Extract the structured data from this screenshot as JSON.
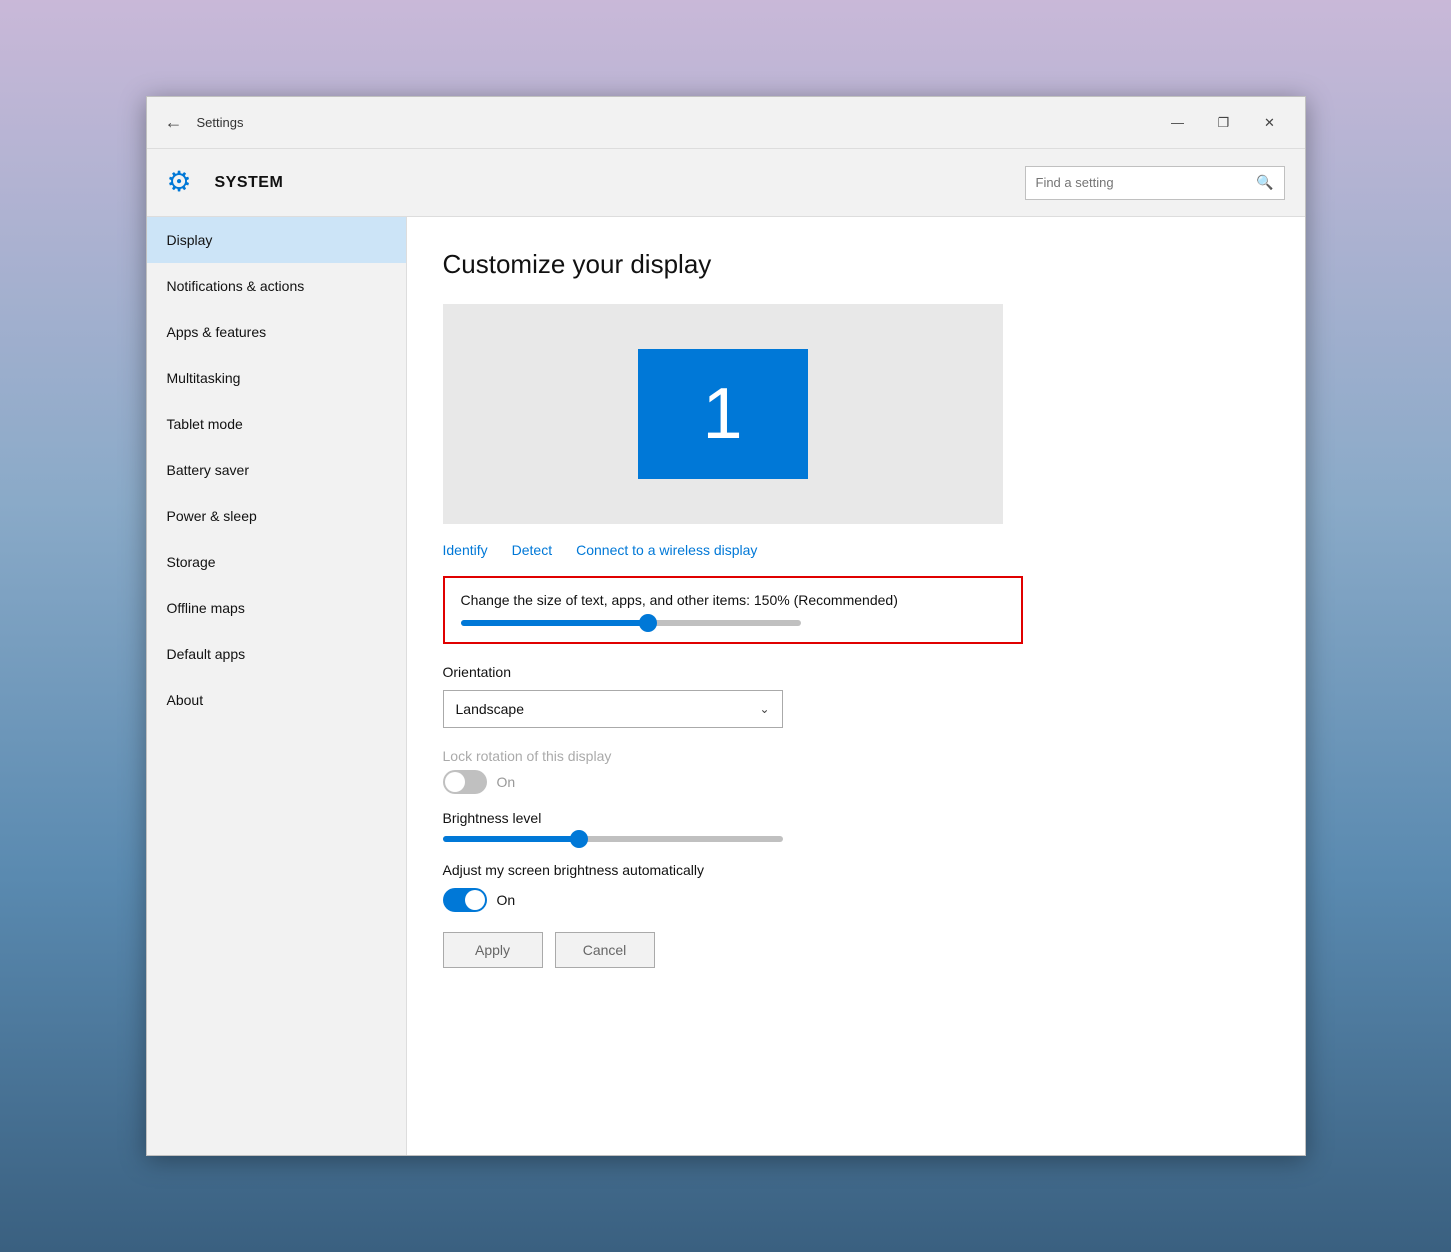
{
  "window": {
    "title": "Settings",
    "min_btn": "—",
    "max_btn": "❐",
    "close_btn": "✕"
  },
  "header": {
    "icon": "⚙",
    "title": "SYSTEM",
    "search_placeholder": "Find a setting",
    "search_icon": "🔍"
  },
  "sidebar": {
    "items": [
      {
        "label": "Display",
        "active": true
      },
      {
        "label": "Notifications & actions",
        "active": false
      },
      {
        "label": "Apps & features",
        "active": false
      },
      {
        "label": "Multitasking",
        "active": false
      },
      {
        "label": "Tablet mode",
        "active": false
      },
      {
        "label": "Battery saver",
        "active": false
      },
      {
        "label": "Power & sleep",
        "active": false
      },
      {
        "label": "Storage",
        "active": false
      },
      {
        "label": "Offline maps",
        "active": false
      },
      {
        "label": "Default apps",
        "active": false
      },
      {
        "label": "About",
        "active": false
      }
    ]
  },
  "main": {
    "title": "Customize your display",
    "monitor_number": "1",
    "links": {
      "identify": "Identify",
      "detect": "Detect",
      "connect": "Connect to a wireless display"
    },
    "scale_section": {
      "label": "Change the size of text, apps, and other items: 150% (Recommended)",
      "slider_percent": 55
    },
    "orientation_section": {
      "title": "Orientation",
      "value": "Landscape"
    },
    "lock_section": {
      "title": "Lock rotation of this display",
      "toggle_state": "off",
      "toggle_label": "On"
    },
    "brightness_section": {
      "title": "Brightness level",
      "slider_percent": 40
    },
    "auto_brightness": {
      "title": "Adjust my screen brightness automatically",
      "toggle_state": "on",
      "toggle_label": "On"
    },
    "apply_btn": "Apply",
    "cancel_btn": "Cancel"
  }
}
